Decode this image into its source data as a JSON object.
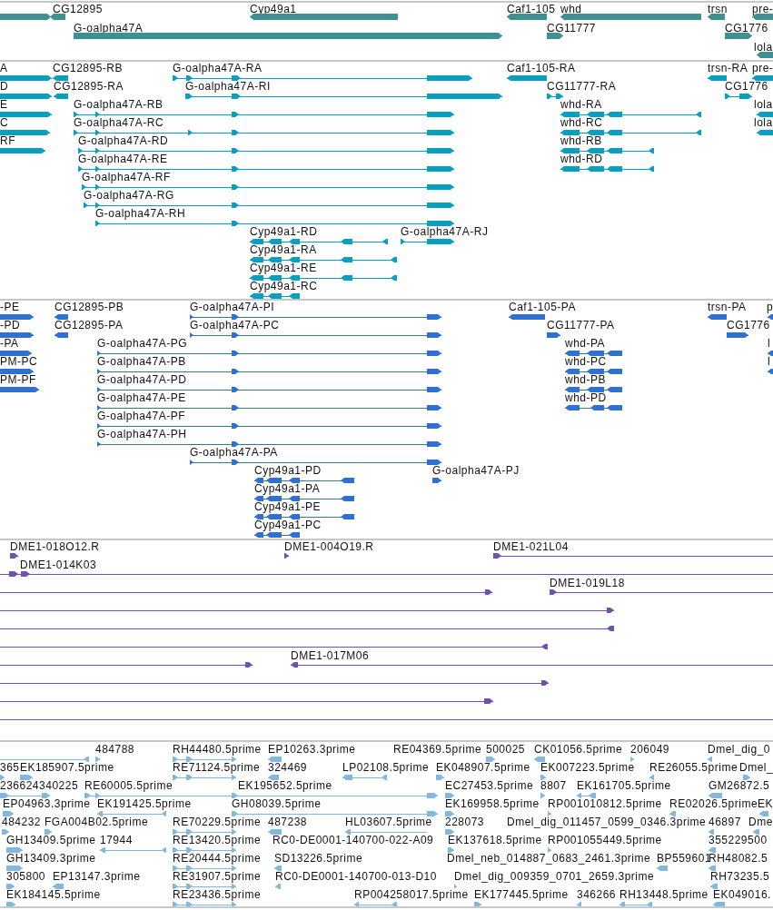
{
  "tracks": [
    {
      "kind": "gene",
      "color": "#3f9090",
      "features": [
        {
          "reverse": false
        },
        {
          "label": "CG12895",
          "reverse": true
        },
        {
          "label": "Cyp49a1",
          "reverse": true
        },
        {
          "label": "G-oalpha47A",
          "reverse": false
        },
        {
          "label": "Caf1-105",
          "reverse": true
        },
        {
          "label": "whd",
          "reverse": true
        },
        {
          "label": "CG11777",
          "reverse": false
        },
        {
          "label": "trsn",
          "reverse": true
        },
        {
          "label": "pre-",
          "reverse": true
        },
        {
          "label": "CG1776",
          "reverse": false
        },
        {
          "label": "lola",
          "reverse": true
        }
      ]
    },
    {
      "kind": "transcript",
      "color": "#08a0c0",
      "features": [
        {
          "label": "A",
          "reverse": false
        },
        {
          "label": "CG12895-RB",
          "reverse": true
        },
        {
          "label": "G-oalpha47A-RA",
          "reverse": false
        },
        {
          "label": "Caf1-105-RA",
          "reverse": true
        },
        {
          "label": "trsn-RA",
          "reverse": true
        },
        {
          "label": "pre-",
          "reverse": true
        },
        {
          "label": "D",
          "reverse": false
        },
        {
          "label": "CG12895-RA",
          "reverse": true
        },
        {
          "label": "G-oalpha47A-RI",
          "reverse": false
        },
        {
          "label": "CG11777-RA",
          "reverse": false
        },
        {
          "label": "CG1776",
          "reverse": false
        },
        {
          "label": "E",
          "reverse": false
        },
        {
          "label": "G-oalpha47A-RB",
          "reverse": false
        },
        {
          "label": "whd-RA",
          "reverse": true
        },
        {
          "label": "lola",
          "reverse": true
        },
        {
          "label": "C",
          "reverse": false
        },
        {
          "label": "G-oalpha47A-RC",
          "reverse": false
        },
        {
          "label": "whd-RC",
          "reverse": true
        },
        {
          "label": "lola",
          "reverse": true
        },
        {
          "label": "RF",
          "reverse": false
        },
        {
          "label": "G-oalpha47A-RD",
          "reverse": false
        },
        {
          "label": "whd-RB",
          "reverse": true
        },
        {
          "label": "G-oalpha47A-RE",
          "reverse": false
        },
        {
          "label": "whd-RD",
          "reverse": true
        },
        {
          "label": "G-oalpha47A-RF",
          "reverse": false
        },
        {
          "label": "G-oalpha47A-RG",
          "reverse": false
        },
        {
          "label": "G-oalpha47A-RH",
          "reverse": false
        },
        {
          "label": "Cyp49a1-RD",
          "reverse": true
        },
        {
          "label": "G-oalpha47A-RJ",
          "reverse": false
        },
        {
          "label": "Cyp49a1-RA",
          "reverse": true
        },
        {
          "label": "Cyp49a1-RE",
          "reverse": true
        },
        {
          "label": "Cyp49a1-RC",
          "reverse": true
        }
      ]
    },
    {
      "kind": "protein",
      "color": "#3070d0",
      "features": [
        {
          "label": "-PE",
          "reverse": false
        },
        {
          "label": "CG12895-PB",
          "reverse": true
        },
        {
          "label": "G-oalpha47A-PI",
          "reverse": false
        },
        {
          "label": "Caf1-105-PA",
          "reverse": true
        },
        {
          "label": "trsn-PA",
          "reverse": true
        },
        {
          "label": "p",
          "reverse": true
        },
        {
          "label": "-PD",
          "reverse": false
        },
        {
          "label": "CG12895-PA",
          "reverse": true
        },
        {
          "label": "G-oalpha47A-PC",
          "reverse": false
        },
        {
          "label": "CG11777-PA",
          "reverse": false
        },
        {
          "label": "CG1776",
          "reverse": false
        },
        {
          "label": "-PA",
          "reverse": false
        },
        {
          "label": "G-oalpha47A-PG",
          "reverse": false
        },
        {
          "label": "whd-PA",
          "reverse": true
        },
        {
          "label": "l",
          "reverse": true
        },
        {
          "label": "PM-PC",
          "reverse": false
        },
        {
          "label": "G-oalpha47A-PB",
          "reverse": false
        },
        {
          "label": "whd-PC",
          "reverse": true
        },
        {
          "label": "l",
          "reverse": true
        },
        {
          "label": "PM-PF",
          "reverse": false
        },
        {
          "label": "G-oalpha47A-PD",
          "reverse": false
        },
        {
          "label": "whd-PB",
          "reverse": true
        },
        {
          "label": "G-oalpha47A-PE",
          "reverse": false
        },
        {
          "label": "whd-PD",
          "reverse": true
        },
        {
          "label": "G-oalpha47A-PF",
          "reverse": false
        },
        {
          "label": "G-oalpha47A-PH",
          "reverse": false
        },
        {
          "label": "G-oalpha47A-PA",
          "reverse": false
        },
        {
          "label": "Cyp49a1-PD",
          "reverse": true
        },
        {
          "label": "G-oalpha47A-PJ",
          "reverse": false
        },
        {
          "label": "Cyp49a1-PA",
          "reverse": true
        },
        {
          "label": "Cyp49a1-PE",
          "reverse": true
        },
        {
          "label": "Cyp49a1-PC",
          "reverse": true
        }
      ]
    },
    {
      "kind": "clone",
      "color": "#7050b0",
      "features": [
        {
          "kind": "arrow",
          "label": "DME1-018O12.R",
          "reverse": false
        },
        {
          "kind": "arrow",
          "label": "DME1-004O19.R",
          "reverse": false
        },
        {
          "kind": "arrow",
          "label": "DME1-021L04",
          "reverse": false
        },
        {
          "kind": "arrow",
          "label": "DME1-014K03",
          "reverse": false
        },
        {
          "kind": "arrow",
          "reverse": false
        },
        {
          "kind": "arrow",
          "label": "DME1-019L18",
          "reverse": false
        },
        {
          "kind": "arrow",
          "reverse": false
        },
        {
          "kind": "arrow",
          "reverse": true
        },
        {
          "kind": "arrow",
          "reverse": true
        },
        {
          "kind": "arrow",
          "reverse": false
        },
        {
          "kind": "arrow",
          "label": "DME1-017M06",
          "reverse": true
        },
        {
          "kind": "arrow",
          "reverse": false
        },
        {
          "kind": "arrow",
          "reverse": false
        },
        {
          "kind": "line"
        }
      ]
    },
    {
      "kind": "est",
      "color": "#80b8e0",
      "features": [
        {
          "reverse": true
        },
        {
          "label": "484788",
          "reverse": false
        },
        {
          "label": "RH44480.5prime",
          "reverse": false
        },
        {
          "label": "EP10263.3prime",
          "reverse": true
        },
        {
          "label": "RE04369.5prime"
        },
        {
          "label": "500025",
          "reverse": false
        },
        {
          "label": "CK01056.5prime",
          "reverse": true
        },
        {
          "label": "206049",
          "reverse": false
        },
        {
          "label": "Dmel_dig_0",
          "reverse": true
        },
        {
          "label": "365",
          "reverse": false
        },
        {
          "label": "EK185907.5prime",
          "reverse": false
        },
        {
          "label": "RE71124.5prime",
          "reverse": false
        },
        {
          "label": "324469",
          "reverse": true
        },
        {
          "label": "LP02108.5prime",
          "reverse": true
        },
        {
          "label": "EK048907.5prime",
          "reverse": false
        },
        {
          "label": "EK007223.5prime",
          "reverse": false
        },
        {
          "label": "RE26055.5prime",
          "reverse": true
        },
        {
          "label": "Dmel_",
          "reverse": false
        },
        {
          "label": "236624340225",
          "reverse": false
        },
        {
          "label": "RE60005.5prime",
          "reverse": false
        },
        {
          "label": "EK195652.5prime",
          "reverse": false
        },
        {
          "label": "EC27453.5prime",
          "reverse": false
        },
        {
          "label": "8807",
          "reverse": false
        },
        {
          "label": "EK161705.5prime",
          "reverse": true
        },
        {
          "label": "GM26872.5",
          "reverse": true
        },
        {
          "label": "EP04963.3prime",
          "reverse": false
        },
        {
          "label": "EK191425.5prime",
          "reverse": true
        },
        {
          "label": "GH08039.5prime",
          "reverse": false
        },
        {
          "label": "EK169958.5prime",
          "reverse": false
        },
        {
          "label": "RP001010812.5prime",
          "reverse": false
        },
        {
          "label": "RE02026.5prime",
          "reverse": true
        },
        {
          "label": "EK",
          "reverse": true
        },
        {
          "label": "484232",
          "reverse": false
        },
        {
          "label": "FGA004B02.5prime",
          "reverse": false
        },
        {
          "label": "RE70229.5prime",
          "reverse": false
        },
        {
          "label": "487238",
          "reverse": true
        },
        {
          "label": "HL03607.5prime",
          "reverse": true
        },
        {
          "label": "228073",
          "reverse": false
        },
        {
          "label": "Dmel_dig_011457_0599_0346.3prime"
        },
        {
          "label": "46897",
          "reverse": true
        },
        {
          "label": "Dme",
          "reverse": true
        },
        {
          "label": "GH13409.5prime",
          "reverse": false
        },
        {
          "label": "17944",
          "reverse": true
        },
        {
          "label": "RE13420.5prime",
          "reverse": false
        },
        {
          "label": "RC0-DE0001-140700-022-A09"
        },
        {
          "label": "EK137618.5prime",
          "reverse": false
        },
        {
          "label": "RP001055449.5prime",
          "reverse": false
        },
        {
          "label": "355229500",
          "reverse": true
        },
        {
          "label": "GH13409.3prime",
          "reverse": false
        },
        {
          "label": "RE20444.5prime",
          "reverse": false
        },
        {
          "label": "SD13226.5prime",
          "reverse": true
        },
        {
          "label": "Dmel_neb_014887_0683_2461.3prime"
        },
        {
          "label": "BP559601",
          "reverse": true
        },
        {
          "label": "RH48082.5",
          "reverse": true
        },
        {
          "label": "305800",
          "reverse": false
        },
        {
          "label": "EP13147.3prime",
          "reverse": true
        },
        {
          "label": "RE31907.5prime",
          "reverse": false
        },
        {
          "label": "RC0-DE0001-140700-013-D10",
          "reverse": true
        },
        {
          "label": "Dmel_dig_009359_0701_2659.3prime",
          "reverse": false
        },
        {
          "label": "RH73235.5",
          "reverse": true
        },
        {
          "label": "EK184145.5prime",
          "reverse": false
        },
        {
          "label": "RE23436.5prime",
          "reverse": false
        },
        {
          "label": "RP004258017.5prime",
          "reverse": true
        },
        {
          "label": "EK177445.5prime",
          "reverse": false
        },
        {
          "label": "346266",
          "reverse": true
        },
        {
          "label": "RH13448.5prime",
          "reverse": true
        },
        {
          "label": "EK049016.",
          "reverse": true
        }
      ]
    }
  ]
}
